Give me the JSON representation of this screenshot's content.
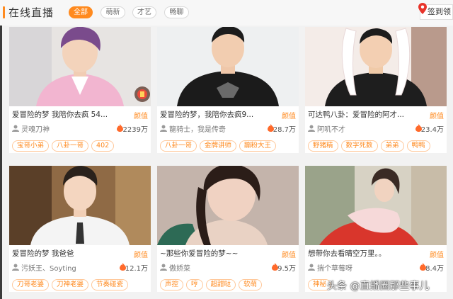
{
  "header": {
    "title": "在线直播",
    "filters": [
      "全部",
      "萌新",
      "才艺",
      "畅聊"
    ],
    "sign_button": "签到领"
  },
  "cards": [
    {
      "title": "爱冒险的梦 我陪你去疯 54...",
      "tag": "颜值",
      "anchor": "灵魂刀神",
      "popularity": "2239万",
      "chips": [
        "宝哥小弟",
        "八卦一哥",
        "402"
      ]
    },
    {
      "title": "爱冒险的梦，我陪你去疯9...",
      "tag": "颜值",
      "anchor": "龍骑士，我是传奇",
      "popularity": "28.7万",
      "chips": [
        "八卦一哥",
        "金牌讲师",
        "蹦粉大王"
      ]
    },
    {
      "title": "可达鸭八卦：爱冒险的阿才...",
      "tag": "颜值",
      "anchor": "阿叽不才",
      "popularity": "23.4万",
      "chips": [
        "野猪精",
        "数字死数",
        "弟弟",
        "鸭鸭"
      ]
    },
    {
      "title": "爱冒险的梦 我爸爸",
      "tag": "颜值",
      "anchor": "污妖王、Soyting",
      "popularity": "12.1万",
      "chips": [
        "刀哥老婆",
        "刀神老婆",
        "节奏碰瓷"
      ]
    },
    {
      "title": "~那些你爱冒险的梦~~",
      "tag": "颜值",
      "anchor": "傲娇菜",
      "popularity": "9.5万",
      "chips": [
        "声控",
        "哼",
        "超甜哒",
        "软萌"
      ]
    },
    {
      "title": "想带你去看晴空万里。。",
      "tag": "颜值",
      "anchor": "揣个草莓呀",
      "popularity": "8.4万",
      "chips": [
        "神秘"
      ]
    }
  ],
  "watermark": "头条 @直播圈那些事儿",
  "icons": {
    "user": "user-icon",
    "hot": "flame-icon",
    "sign": "location-pin-icon",
    "badge": "anchor-badge-icon"
  },
  "colors": {
    "accent": "#ff8a1f",
    "sign_pin": "#e8342a"
  }
}
